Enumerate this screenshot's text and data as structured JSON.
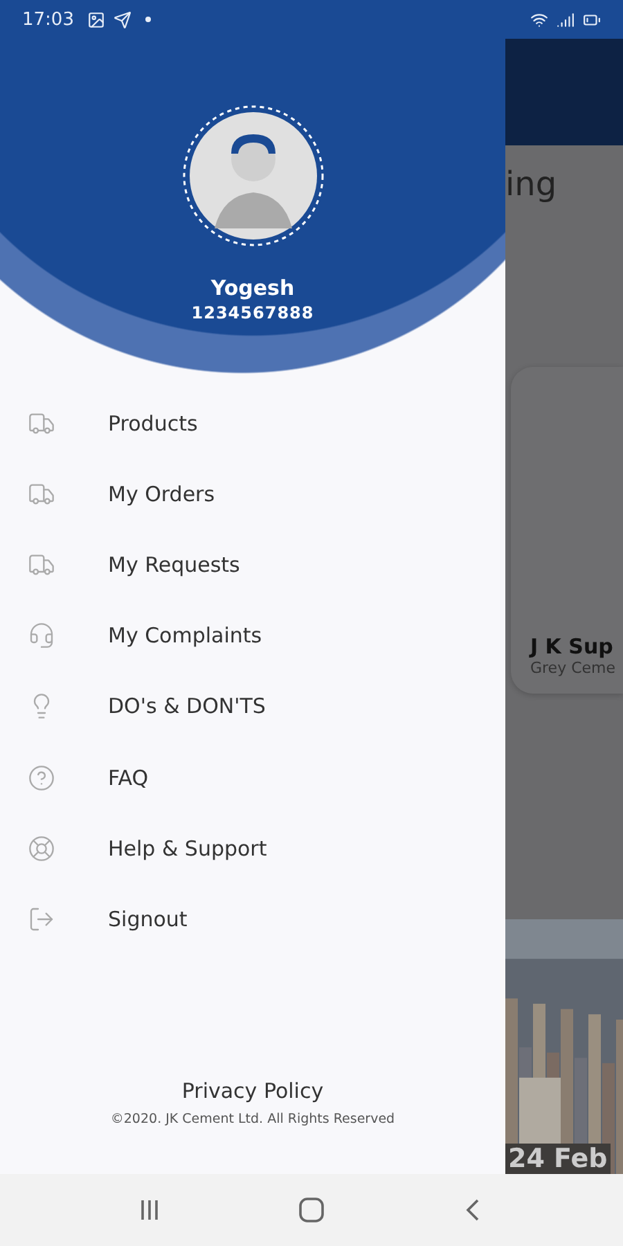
{
  "status_bar": {
    "time": "17:03"
  },
  "drawer": {
    "user": {
      "name": "Yogesh",
      "phone": "1234567888"
    },
    "menu": [
      {
        "label": "Products"
      },
      {
        "label": "My Orders"
      },
      {
        "label": "My Requests"
      },
      {
        "label": "My Complaints"
      },
      {
        "label": "DO's & DON'TS"
      },
      {
        "label": "FAQ"
      },
      {
        "label": "Help & Support"
      },
      {
        "label": "Signout"
      }
    ],
    "privacy_policy": "Privacy Policy",
    "copyright": "©2020. JK Cement Ltd. All Rights Reserved"
  },
  "background_screen": {
    "heading": "ing",
    "card": {
      "title": "J K Sup",
      "subtitle": "Grey Ceme"
    },
    "banner": {
      "date": "24 Feb"
    }
  }
}
